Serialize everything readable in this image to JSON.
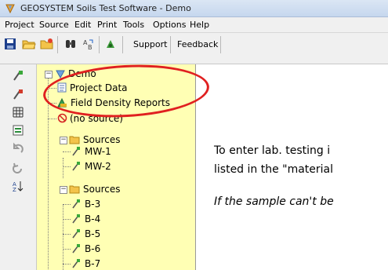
{
  "window": {
    "title": "GEOSYSTEM Soils Test Software - Demo"
  },
  "menu": [
    {
      "label": "Project"
    },
    {
      "label": "Source"
    },
    {
      "label": "Edit"
    },
    {
      "label": "Print"
    },
    {
      "label": "Tools"
    },
    {
      "label": "Options"
    },
    {
      "label": "Help"
    }
  ],
  "toolbar": {
    "icons": [
      "save-icon",
      "open-folder-icon",
      "new-folder-icon",
      "binoculars-icon",
      "replace-icon",
      "tool-icon"
    ],
    "support_label": "Support",
    "feedback_label": "Feedback"
  },
  "side_tools": [
    "add-source-icon",
    "edit-source-icon",
    "grid-icon",
    "report-icon",
    "undo-icon",
    "redo-icon",
    "sort-az-icon"
  ],
  "tree": {
    "root": "Demo",
    "items": [
      {
        "label": "Project Data",
        "icon": "document-icon"
      },
      {
        "label": "Field Density Reports",
        "icon": "field-density-icon"
      },
      {
        "label": "(no source)",
        "icon": "no-source-icon"
      },
      {
        "label": "Sources",
        "icon": "folder-icon"
      },
      {
        "label": "MW-1",
        "icon": "borehole-icon"
      },
      {
        "label": "MW-2",
        "icon": "borehole-icon"
      },
      {
        "label": "Sources",
        "icon": "folder-icon"
      },
      {
        "label": "B-3",
        "icon": "borehole-icon"
      },
      {
        "label": "B-4",
        "icon": "borehole-icon"
      },
      {
        "label": "B-5",
        "icon": "borehole-icon"
      },
      {
        "label": "B-6",
        "icon": "borehole-icon"
      },
      {
        "label": "B-7",
        "icon": "borehole-icon"
      }
    ]
  },
  "content": {
    "line1": "To enter lab. testing i",
    "line2": "listed in the \"material",
    "line3": "If the sample can't be"
  },
  "colors": {
    "tree_bg": "#ffffb4",
    "highlight": "#e02020"
  }
}
